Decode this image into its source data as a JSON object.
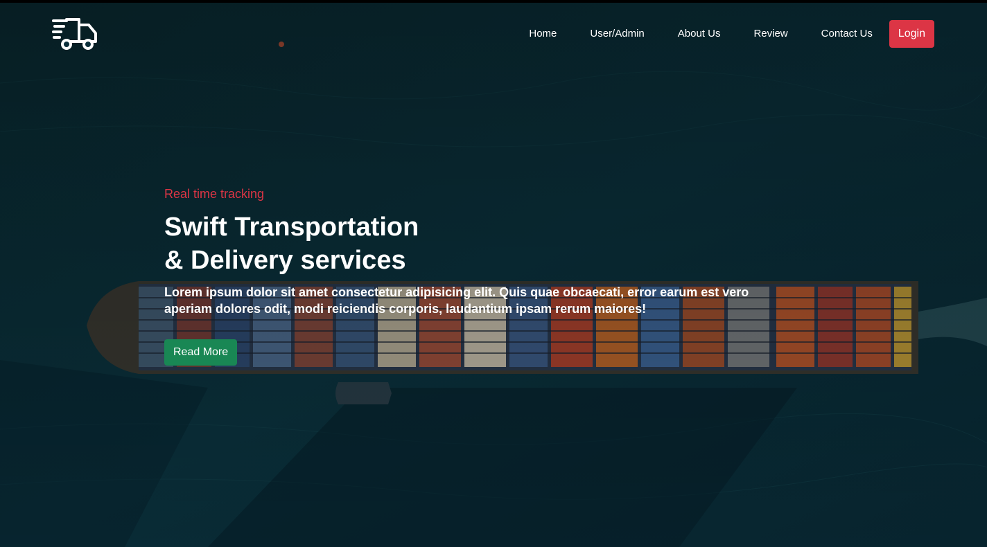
{
  "nav": {
    "logo_icon": "delivery-truck-icon",
    "links": [
      {
        "label": "Home"
      },
      {
        "label": "User/Admin"
      },
      {
        "label": "About Us"
      },
      {
        "label": "Review"
      },
      {
        "label": "Contact Us"
      }
    ],
    "login_label": "Login"
  },
  "hero": {
    "kicker": "Real time tracking",
    "title_line1": "Swift Transportation",
    "title_line2": "& Delivery services",
    "text": "Lorem ipsum dolor sit amet consectetur adipisicing elit. Quis quae obcaecati, error earum est vero aperiam dolores odit, modi reiciendis corporis, laudantium ipsam rerum maiores!",
    "button_label": "Read More"
  },
  "colors": {
    "accent_red": "#dc3545",
    "button_green": "#198754",
    "ocean": "#0b2f3a"
  }
}
